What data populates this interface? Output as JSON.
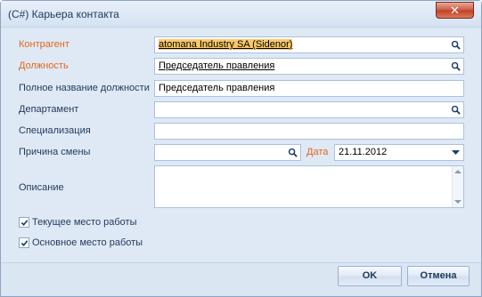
{
  "window": {
    "title": "(C#) Карьера контакта",
    "close_label": "✕"
  },
  "form": {
    "counterparty": {
      "label": "Контрагент",
      "value_head": "atomana Industry SA (Sidenor)",
      "value_tail": ""
    },
    "position": {
      "label": "Должность",
      "value": "Председатель правления"
    },
    "full_position": {
      "label": "Полное название должности",
      "value": "Председатель правления"
    },
    "department": {
      "label": "Департамент",
      "value": ""
    },
    "specialization": {
      "label": "Специализация",
      "value": ""
    },
    "change_reason": {
      "label": "Причина смены",
      "value": ""
    },
    "date": {
      "label": "Дата",
      "value": "21.11.2012"
    },
    "description": {
      "label": "Описание",
      "value": ""
    },
    "current_job": {
      "label": "Текущее место работы",
      "checked": true
    },
    "main_job": {
      "label": "Основное место работы",
      "checked": true
    }
  },
  "footer": {
    "ok_label": "OK",
    "cancel_label": "Отмена"
  },
  "icons": {
    "lookup": "search-icon",
    "dropdown": "chevron-down-icon",
    "check": "checkmark-icon"
  },
  "colors": {
    "required_label": "#e3661a",
    "label": "#1e395b",
    "close_button": "#c23f25"
  }
}
